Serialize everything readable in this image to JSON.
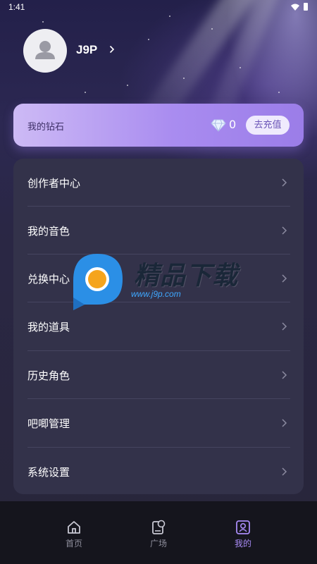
{
  "status_bar": {
    "time": "1:41"
  },
  "profile": {
    "username": "J9P"
  },
  "diamond_card": {
    "label": "我的钻石",
    "count": "0",
    "recharge_label": "去充值"
  },
  "menu": {
    "items": [
      {
        "label": "创作者中心"
      },
      {
        "label": "我的音色"
      },
      {
        "label": "兑换中心"
      },
      {
        "label": "我的道具"
      },
      {
        "label": "历史角色"
      },
      {
        "label": "吧唧管理"
      },
      {
        "label": "系统设置"
      }
    ]
  },
  "watermark": {
    "title": "精品下载",
    "url": "www.j9p.com"
  },
  "bottom_nav": {
    "tabs": [
      {
        "label": "首页",
        "icon": "home-icon",
        "active": false
      },
      {
        "label": "广场",
        "icon": "plaza-icon",
        "active": false
      },
      {
        "label": "我的",
        "icon": "profile-icon",
        "active": true
      }
    ]
  },
  "colors": {
    "accent": "#a88bf5",
    "card": "#33324a",
    "nav_background": "#15151d"
  }
}
